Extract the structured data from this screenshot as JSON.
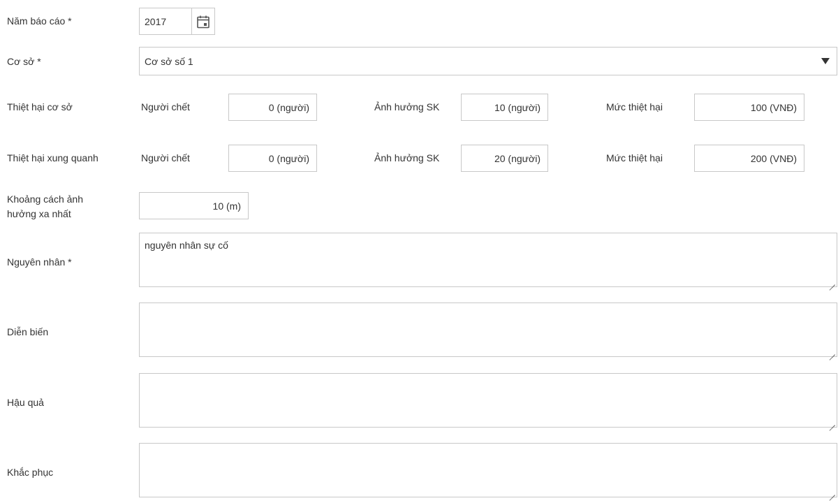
{
  "form": {
    "year": {
      "label": "Năm báo cáo *",
      "value": "2017"
    },
    "facility": {
      "label": "Cơ sở *",
      "value": "Cơ sở số 1"
    },
    "damage_facility": {
      "label": "Thiệt hại cơ sở",
      "deaths_label": "Người chết",
      "deaths_value": "0 (người)",
      "health_label": "Ảnh hưởng SK",
      "health_value": "10 (người)",
      "loss_label": "Mức thiệt hại",
      "loss_value": "100 (VNĐ)"
    },
    "damage_surrounding": {
      "label": "Thiệt hại xung quanh",
      "deaths_label": "Người chết",
      "deaths_value": "0 (người)",
      "health_label": "Ảnh hưởng SK",
      "health_value": "20 (người)",
      "loss_label": "Mức thiệt hại",
      "loss_value": "200 (VNĐ)"
    },
    "distance": {
      "label_line1": "Khoảng cách ảnh",
      "label_line2": "hưởng xa nhất",
      "value": "10 (m)"
    },
    "cause": {
      "label": "Nguyên nhân *",
      "value": "nguyên nhân sự cố"
    },
    "progress": {
      "label": "Diễn biến",
      "value": ""
    },
    "consequence": {
      "label": "Hậu quả",
      "value": ""
    },
    "remedy": {
      "label": "Khắc phục",
      "value": ""
    }
  },
  "icons": {
    "calendar": "calendar-icon",
    "dropdown": "caret-down-icon"
  },
  "colors": {
    "border": "#c8c8c8",
    "text": "#333333",
    "background": "#ffffff"
  }
}
